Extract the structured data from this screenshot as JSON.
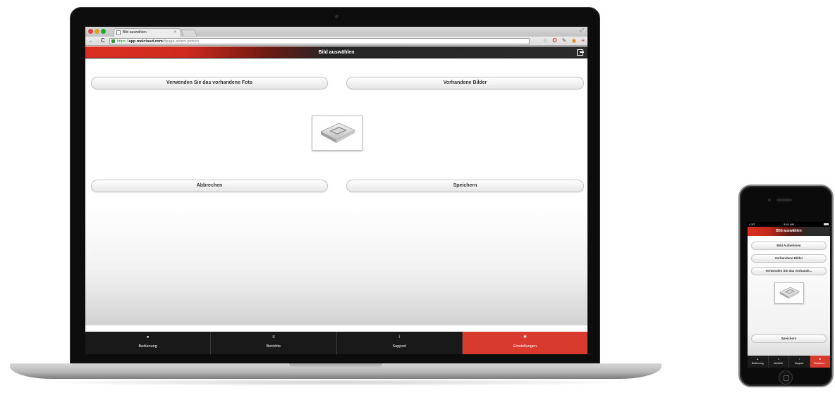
{
  "browser": {
    "tab_title": "Bild auswählen",
    "tab_close": "×",
    "url_scheme": "https://",
    "url_host": "app.melcloud.com",
    "url_path": "/#page-select-picture"
  },
  "app": {
    "title": "Bild auswählen",
    "buttons": {
      "use_existing_photo": "Verwenden Sie das vorhandene Foto",
      "existing_images": "Vorhandene Bilder",
      "cancel": "Abbrechen",
      "save": "Speichern"
    },
    "tabs": [
      {
        "label": "Bedienung",
        "icon": "●",
        "active": false
      },
      {
        "label": "Berichte",
        "icon": "≡",
        "active": false
      },
      {
        "label": "Support",
        "icon": "i",
        "active": false
      },
      {
        "label": "Einstellungen",
        "icon": "✱",
        "active": true
      }
    ],
    "accent_color": "#d93a2e"
  },
  "phone": {
    "status_signal": "ıl 3G",
    "status_time": "9:41 AM",
    "title": "Bild auswählen",
    "buttons": {
      "take_picture": "Bild Aufnehmen",
      "existing_images": "Vorhandene Bilder",
      "use_existing": "Verwenden Sie das vorhande...",
      "save": "Speichern"
    },
    "tabs": [
      {
        "label": "Bedienung",
        "icon": "●"
      },
      {
        "label": "Berichte",
        "icon": "≡"
      },
      {
        "label": "Support",
        "icon": "i"
      },
      {
        "label": "Einstellun...",
        "icon": "✱"
      }
    ]
  }
}
